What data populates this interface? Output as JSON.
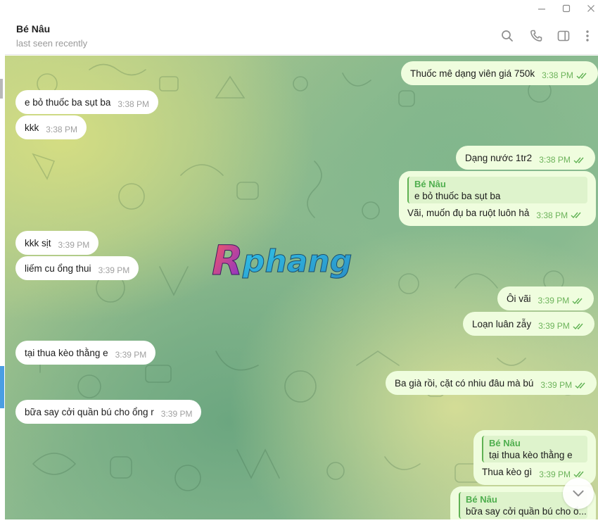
{
  "window": {
    "minimize_icon": "minimize-icon",
    "maximize_icon": "maximize-icon",
    "close_icon": "close-icon"
  },
  "header": {
    "name": "Bé Nâu",
    "status": "last seen recently",
    "icons": [
      "search-icon",
      "phone-icon",
      "sidebar-icon",
      "more-vertical-icon"
    ]
  },
  "watermark": {
    "text": "Rphang"
  },
  "messages": [
    {
      "dir": "out",
      "text": "Thuốc mê dạng viên giá 750k",
      "time": "3:38 PM"
    },
    {
      "dir": "in",
      "text": "e bỏ thuốc ba sụt ba",
      "time": "3:38 PM"
    },
    {
      "dir": "in",
      "text": "kkk",
      "time": "3:38 PM"
    },
    {
      "dir": "out",
      "text": "Dạng nước 1tr2",
      "time": "3:38 PM"
    },
    {
      "dir": "out",
      "reply_name": "Bé Nâu",
      "reply_text": "e bỏ thuốc ba sụt ba",
      "text": "Vãi, muốn đụ ba ruột luôn hả",
      "time": "3:38 PM"
    },
    {
      "dir": "in",
      "text": "kkk sịt",
      "time": "3:39 PM"
    },
    {
      "dir": "in",
      "text": "liếm cu ổng thui",
      "time": "3:39 PM"
    },
    {
      "dir": "out",
      "text": "Ôi vãi",
      "time": "3:39 PM"
    },
    {
      "dir": "out",
      "text": "Loạn luân zẫy",
      "time": "3:39 PM"
    },
    {
      "dir": "in",
      "text": "tại thua kèo thằng e",
      "time": "3:39 PM"
    },
    {
      "dir": "out",
      "text": "Ba già rồi, cặt có nhiu đâu mà bú",
      "time": "3:39 PM"
    },
    {
      "dir": "in",
      "text": "bữa say cởi quần bú cho ổng r",
      "time": "3:39 PM"
    },
    {
      "dir": "out",
      "reply_name": "Bé Nâu",
      "reply_text": "tại thua kèo thằng e",
      "text": "Thua kèo gì",
      "time": "3:39 PM"
    },
    {
      "dir": "out",
      "reply_name": "Bé Nâu",
      "reply_text": "bữa say cởi quần bú cho ổ..."
    }
  ],
  "colors": {
    "incoming_bubble": "#ffffff",
    "outgoing_bubble": "#effdde",
    "outgoing_time": "#6cb35a",
    "quote_accent": "#4fae4e"
  }
}
